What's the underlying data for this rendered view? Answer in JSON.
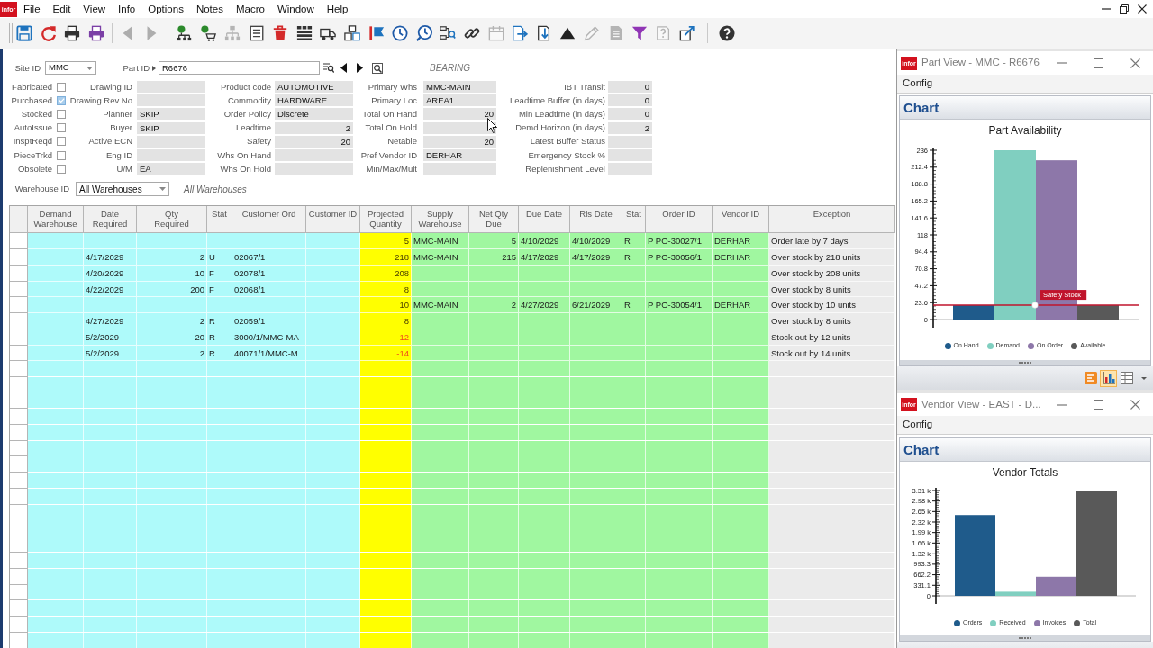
{
  "app": {
    "logo": "infor",
    "menu": [
      "File",
      "Edit",
      "View",
      "Info",
      "Options",
      "Notes",
      "Macro",
      "Window",
      "Help"
    ],
    "toolbar": [
      {
        "disabled": false
      },
      {
        "disabled": false
      },
      {
        "disabled": false
      },
      {
        "disabled": false
      },
      {
        "disabled": true
      },
      {
        "disabled": true
      },
      {
        "disabled": false
      },
      {
        "disabled": false
      },
      {
        "disabled": true
      },
      {
        "disabled": false
      },
      {
        "disabled": false
      },
      {
        "disabled": false
      },
      {
        "disabled": false
      },
      {
        "disabled": false
      },
      {
        "disabled": false
      },
      {
        "disabled": false
      },
      {
        "disabled": false
      },
      {
        "disabled": false
      },
      {
        "disabled": false
      },
      {
        "disabled": true
      },
      {
        "disabled": false
      },
      {
        "disabled": false
      },
      {
        "disabled": false
      },
      {
        "disabled": true
      },
      {
        "disabled": true
      },
      {
        "disabled": false
      },
      {
        "disabled": true
      },
      {
        "disabled": false
      },
      {
        "disabled": false
      }
    ]
  },
  "part_header": {
    "site": {
      "label": "Site ID",
      "value": "MMC"
    },
    "part": {
      "label": "Part ID",
      "value": "R6676"
    },
    "description": "BEARING",
    "flags": [
      {
        "label": "Fabricated",
        "checked": false
      },
      {
        "label": "Purchased",
        "checked": true
      },
      {
        "label": "Stocked",
        "checked": false
      },
      {
        "label": "AutoIssue",
        "checked": false
      },
      {
        "label": "InsptReqd",
        "checked": false
      },
      {
        "label": "PieceTrkd",
        "checked": false
      },
      {
        "label": "Obsolete",
        "checked": false
      }
    ],
    "field_groups": [
      [
        {
          "label": "Drawing ID"
        },
        {
          "label": "Drawing Rev No"
        },
        {
          "label": "Planner",
          "kind": "text",
          "value": "SKIP"
        },
        {
          "label": "Buyer",
          "kind": "text",
          "value": "SKIP"
        },
        {
          "label": "Active ECN"
        },
        {
          "label": "Eng ID"
        },
        {
          "label": "U/M",
          "kind": "text",
          "value": "EA"
        }
      ],
      [
        {
          "label": "Product code",
          "kind": "text",
          "value": "AUTOMOTIVE"
        },
        {
          "label": "Commodity",
          "kind": "text",
          "value": "HARDWARE"
        },
        {
          "label": "Order Policy",
          "kind": "text",
          "value": "Discrete"
        },
        {
          "label": "Leadtime",
          "kind": "number",
          "value": "2"
        },
        {
          "label": "Safety",
          "kind": "number",
          "value": "20"
        },
        {
          "label": "Whs On Hand"
        },
        {
          "label": "Whs On Hold"
        }
      ],
      [
        {
          "label": "Primary Whs",
          "kind": "text",
          "value": "MMC-MAIN"
        },
        {
          "label": "Primary Loc",
          "kind": "text",
          "value": "AREA1"
        },
        {
          "label": "Total On Hand",
          "kind": "number",
          "value": "20"
        },
        {
          "label": "Total On Hold"
        },
        {
          "label": "Netable",
          "kind": "number",
          "value": "20"
        },
        {
          "label": "Pref Vendor ID",
          "kind": "text",
          "value": "DERHAR"
        },
        {
          "label": "Min/Max/Mult"
        }
      ],
      [
        {
          "label": "IBT Transit",
          "kind": "number",
          "value": "0"
        },
        {
          "label": "Leadtime Buffer (in days)",
          "kind": "number",
          "value": "0"
        },
        {
          "label": "Min Leadtime (in days)",
          "kind": "number",
          "value": "0"
        },
        {
          "label": "Demd Horizon (in days)",
          "kind": "number",
          "value": "2"
        },
        {
          "label": "Latest Buffer Status"
        },
        {
          "label": "Emergency Stock %"
        },
        {
          "label": "Replenishment Level"
        }
      ]
    ],
    "warehouse": {
      "label": "Warehouse ID",
      "value": "All Warehouses",
      "description": "All Warehouses"
    }
  },
  "grid": {
    "columns": [
      {
        "label": "Demand Warehouse",
        "kind": "demand"
      },
      {
        "label": "Date Required",
        "kind": "demand"
      },
      {
        "label": "Qty Required",
        "kind": "demand",
        "numeric": true
      },
      {
        "label": "Stat",
        "kind": "demand"
      },
      {
        "label": "Customer Ord",
        "kind": "demand"
      },
      {
        "label": "Customer ID",
        "kind": "demand"
      },
      {
        "label": "Projected Quantity",
        "kind": "projected",
        "numeric": true
      },
      {
        "label": "Supply Warehouse",
        "kind": "supply"
      },
      {
        "label": "Net Qty Due",
        "kind": "supply",
        "numeric": true
      },
      {
        "label": "Due Date",
        "kind": "supply"
      },
      {
        "label": "Rls Date",
        "kind": "supply"
      },
      {
        "label": "Stat",
        "kind": "supply"
      },
      {
        "label": "Order ID",
        "kind": "supply"
      },
      {
        "label": "Vendor ID",
        "kind": "supply"
      },
      {
        "label": "Exception",
        "kind": "exception"
      }
    ],
    "rows": [
      {
        "cells": [
          null,
          null,
          null,
          null,
          null,
          null,
          "5",
          "MMC-MAIN",
          "5",
          "4/10/2029",
          "4/10/2029",
          "R",
          "P PO-30027/1",
          "DERHAR",
          "Order late by 7 days"
        ],
        "stock_out": false
      },
      {
        "cells": [
          null,
          "4/17/2029",
          "2",
          "U",
          "02067/1",
          null,
          "218",
          "MMC-MAIN",
          "215",
          "4/17/2029",
          "4/17/2029",
          "R",
          "P PO-30056/1",
          "DERHAR",
          "Over stock by 218 units"
        ],
        "stock_out": false
      },
      {
        "cells": [
          null,
          "4/20/2029",
          "10",
          "F",
          "02078/1",
          null,
          "208",
          null,
          null,
          null,
          null,
          null,
          null,
          null,
          "Over stock by 208 units"
        ],
        "stock_out": false
      },
      {
        "cells": [
          null,
          "4/22/2029",
          "200",
          "F",
          "02068/1",
          null,
          "8",
          null,
          null,
          null,
          null,
          null,
          null,
          null,
          "Over stock by 8 units"
        ],
        "stock_out": false
      },
      {
        "cells": [
          null,
          null,
          null,
          null,
          null,
          null,
          "10",
          "MMC-MAIN",
          "2",
          "4/27/2029",
          "6/21/2029",
          "R",
          "P PO-30054/1",
          "DERHAR",
          "Over stock by 10 units"
        ],
        "stock_out": false
      },
      {
        "cells": [
          null,
          "4/27/2029",
          "2",
          "R",
          "02059/1",
          null,
          "8",
          null,
          null,
          null,
          null,
          null,
          null,
          null,
          "Over stock by 8 units"
        ],
        "stock_out": false
      },
      {
        "cells": [
          null,
          "5/2/2029",
          "20",
          "R",
          "3000/1/MMC-MA",
          null,
          "-12",
          null,
          null,
          null,
          null,
          null,
          null,
          null,
          "Stock out by 12 units"
        ],
        "stock_out": true
      },
      {
        "cells": [
          null,
          "5/2/2029",
          "2",
          "R",
          "40071/1/MMC-M",
          null,
          "-14",
          null,
          null,
          null,
          null,
          null,
          null,
          null,
          "Stock out by 14 units"
        ],
        "stock_out": true
      }
    ]
  },
  "panels": [
    {
      "logo": "infor",
      "title": "Part View - MMC - R6676",
      "menu": [
        "Config"
      ],
      "section": "Chart",
      "chart_data": [
        {
          "type": "bar",
          "title": "Part Availability",
          "categories": [
            null
          ],
          "series": [
            {
              "name": "On Hand",
              "color": "#1f5b8b",
              "values": [
                20
              ]
            },
            {
              "name": "Demand",
              "color": "#80cfc0",
              "values": [
                236
              ]
            },
            {
              "name": "On Order",
              "color": "#8d77a9",
              "values": [
                222
              ]
            },
            {
              "name": "Available",
              "color": "#595959",
              "values": [
                20
              ]
            }
          ],
          "ylim": [
            0,
            236
          ],
          "yticks": [
            0,
            23.6,
            47.2,
            70.8,
            94.4,
            118,
            141.6,
            165.2,
            188.8,
            212.4,
            236
          ],
          "ref_lines": [
            {
              "axis": "y",
              "value": 20,
              "label": "Safety Stock",
              "color": "#c0142c"
            }
          ],
          "legend": "bottom"
        }
      ],
      "view_buttons": [
        {
          "selected": false
        },
        {
          "selected": true
        },
        {
          "selected": false
        }
      ]
    },
    {
      "logo": "infor",
      "title": "Vendor View - EAST - D...",
      "menu": [
        "Config"
      ],
      "section": "Chart",
      "chart_data": [
        {
          "type": "bar",
          "title": "Vendor Totals",
          "categories": [
            null
          ],
          "series": [
            {
              "name": "Orders",
              "color": "#1f5b8b",
              "values": [
                2540
              ]
            },
            {
              "name": "Received",
              "color": "#80cfc0",
              "values": [
                130
              ]
            },
            {
              "name": "Invoices",
              "color": "#8d77a9",
              "values": [
                600
              ]
            },
            {
              "name": "Total",
              "color": "#595959",
              "values": [
                3310
              ]
            }
          ],
          "ylim": [
            0,
            3310
          ],
          "yticks": [
            0,
            331.1,
            662.2,
            993.3,
            {
              "value": 1320,
              "label": "1.32 k"
            },
            {
              "value": 1660,
              "label": "1.66 k"
            },
            {
              "value": 1990,
              "label": "1.99 k"
            },
            {
              "value": 2320,
              "label": "2.32 k"
            },
            {
              "value": 2650,
              "label": "2.65 k"
            },
            {
              "value": 2980,
              "label": "2.98 k"
            },
            {
              "value": 3310,
              "label": "3.31 k"
            }
          ],
          "legend": "bottom"
        }
      ]
    }
  ]
}
